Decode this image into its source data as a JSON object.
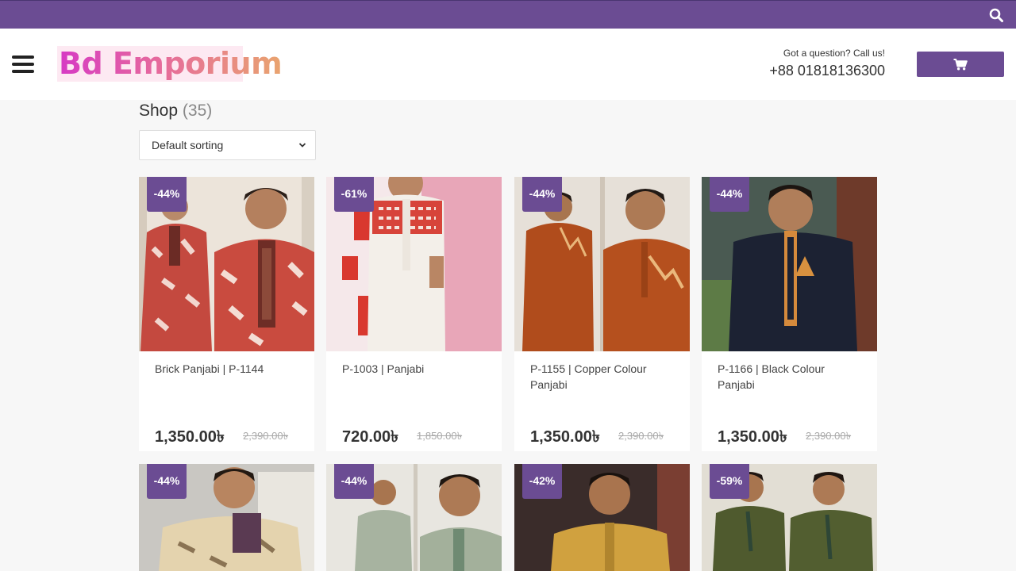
{
  "header": {
    "logo_text": "Bd Emporium",
    "contact_question": "Got a question? Call us!",
    "contact_phone": "+88 01818136300",
    "icons": {
      "search": "search-icon",
      "menu": "hamburger-menu-icon",
      "cart": "cart-icon"
    }
  },
  "shop": {
    "title": "Shop",
    "count": "(35)",
    "sort_selected": "Default sorting"
  },
  "colors": {
    "accent": "#6b4c93",
    "text": "#333333",
    "muted": "#aaaaaa"
  },
  "products": [
    {
      "discount": "-44%",
      "name": "Brick Panjabi | P-1144",
      "price": "1,350.00৳",
      "old_price": "2,390.00৳"
    },
    {
      "discount": "-61%",
      "name": "P-1003 | Panjabi",
      "price": "720.00৳",
      "old_price": "1,850.00৳"
    },
    {
      "discount": "-44%",
      "name": "P-1155 | Copper Colour Panjabi",
      "price": "1,350.00৳",
      "old_price": "2,390.00৳"
    },
    {
      "discount": "-44%",
      "name": "P-1166 | Black Colour Panjabi",
      "price": "1,350.00৳",
      "old_price": "2,390.00৳"
    },
    {
      "discount": "-44%"
    },
    {
      "discount": "-44%"
    },
    {
      "discount": "-42%"
    },
    {
      "discount": "-59%"
    }
  ]
}
